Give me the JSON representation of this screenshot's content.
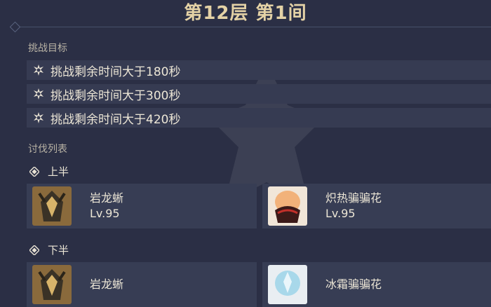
{
  "header": {
    "title": "第12层 第1间"
  },
  "objectives": {
    "label": "挑战目标",
    "items": [
      {
        "text": "挑战剩余时间大于180秒"
      },
      {
        "text": "挑战剩余时间大于300秒"
      },
      {
        "text": "挑战剩余时间大于420秒"
      }
    ]
  },
  "enemies": {
    "label": "讨伐列表",
    "first_half": {
      "label": "上半",
      "cards": [
        {
          "name": "岩龙蜥",
          "level": "Lv.95"
        },
        {
          "name": "炽热骗骗花",
          "level": "Lv.95"
        }
      ]
    },
    "second_half": {
      "label": "下半",
      "cards": [
        {
          "name": "岩龙蜥"
        },
        {
          "name": "冰霜骗骗花"
        }
      ]
    }
  },
  "colors": {
    "background": "#2b2f45",
    "title_gold": "#e4d2a6",
    "row_bg": "#363b52"
  }
}
